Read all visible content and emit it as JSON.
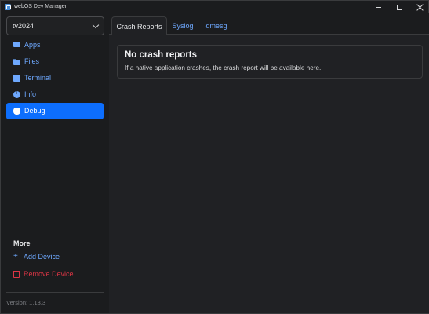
{
  "window": {
    "title": "webOS Dev Manager",
    "controls": [
      "minimize-icon",
      "maximize-icon",
      "close-icon"
    ]
  },
  "sidebar": {
    "device_select": {
      "value": "tv2024"
    },
    "nav": [
      {
        "label": "Apps",
        "icon": "monitor-icon",
        "active": false
      },
      {
        "label": "Files",
        "icon": "folder-icon",
        "active": false
      },
      {
        "label": "Terminal",
        "icon": "terminal-icon",
        "active": false
      },
      {
        "label": "Info",
        "icon": "info-icon",
        "active": false
      },
      {
        "label": "Debug",
        "icon": "bug-icon",
        "active": true
      }
    ],
    "more_heading": "More",
    "actions": {
      "add_device": {
        "label": "Add Device",
        "icon": "plus-icon",
        "glyph": "+"
      },
      "remove_device": {
        "label": "Remove Device",
        "icon": "trash-icon"
      }
    },
    "version": "Version: 1.13.3"
  },
  "main": {
    "tabs": [
      {
        "label": "Crash Reports",
        "active": true
      },
      {
        "label": "Syslog",
        "active": false
      },
      {
        "label": "dmesg",
        "active": false
      }
    ],
    "empty_state": {
      "title": "No crash reports",
      "message": "If a native application crashes, the crash report will be available here."
    }
  },
  "colors": {
    "accent": "#0d6efd",
    "link": "#6ea8fe",
    "danger": "#dc3545",
    "background": "#1b1c1e"
  }
}
